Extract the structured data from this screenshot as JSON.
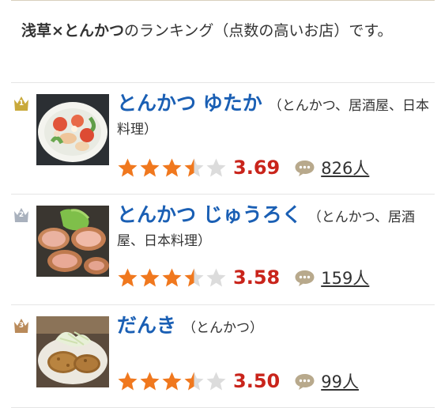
{
  "intro": {
    "area": "浅草",
    "cross": "×",
    "genre": "とんかつ",
    "rest": "のランキング（点数の高いお店）です。"
  },
  "rankings": [
    {
      "rank": "1",
      "name": "とんかつ ゆたか",
      "categories": "（とんかつ、居酒屋、日本料理）",
      "stars": 3.5,
      "score": "3.69",
      "reviews": "826人",
      "badge_color": "#c9a93b"
    },
    {
      "rank": "2",
      "name": "とんかつ じゅうろく",
      "categories": "（とんかつ、居酒屋、日本料理）",
      "stars": 3.5,
      "score": "3.58",
      "reviews": "159人",
      "badge_color": "#a9b1bd"
    },
    {
      "rank": "3",
      "name": "だんき",
      "categories": "（とんかつ）",
      "stars": 3.5,
      "score": "3.50",
      "reviews": "99人",
      "badge_color": "#b98a5a"
    }
  ],
  "icons": {
    "crown": "crown-icon",
    "star": "star-icon",
    "review": "speech-bubble-icon"
  },
  "colors": {
    "star_on": "#f0781e",
    "star_off": "#dcdcdc",
    "score": "#c9241b",
    "link": "#1a5fb4"
  }
}
